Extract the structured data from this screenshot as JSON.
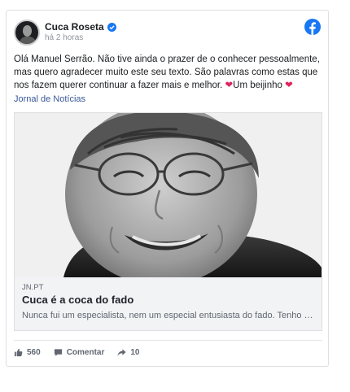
{
  "post": {
    "author": "Cuca Roseta",
    "time": "há 2 horas",
    "text_1": "Olá Manuel Serrão. Não tive ainda o prazer de o conhecer pessoalmente, mas quero agradecer muito este seu texto. São palavras como estas que nos fazem querer continuar a fazer mais e melhor. ",
    "heart": "❤",
    "text_2": "Um beijinho ",
    "source": "Jornal de Notícias"
  },
  "link": {
    "domain": "JN.PT",
    "title": "Cuca é a coca do fado",
    "description": "Nunca fui um especialista, nem um especial entusiasta do fado. Tenho uma forma muito peculiar de gostar de músic..."
  },
  "actions": {
    "likes": "560",
    "comment_label": "Comentar",
    "shares": "10"
  },
  "colors": {
    "facebook_blue": "#1877f2",
    "link_blue": "#385898",
    "heart_red": "#e0245e"
  },
  "icons": [
    "verified-badge-icon",
    "facebook-logo-icon",
    "thumbs-up-icon",
    "comment-icon",
    "share-icon"
  ]
}
